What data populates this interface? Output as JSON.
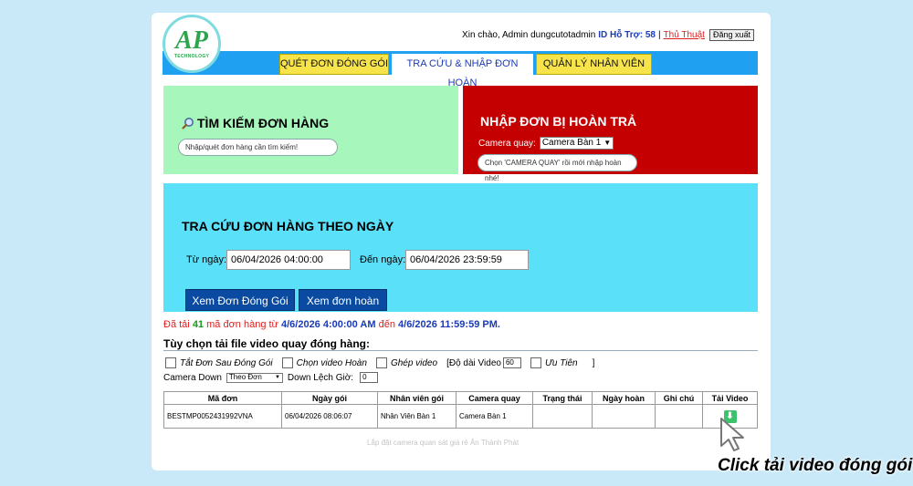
{
  "brand": {
    "logo_text": "AP",
    "logo_sub": "TECHNOLOGY"
  },
  "header": {
    "greeting": "Xin chào, Admin dungcutotadmin",
    "support": "ID Hỗ Trợ: 58",
    "sep": "|",
    "tips": "Thủ Thuật",
    "logout": "Đăng xuất"
  },
  "tabs": [
    {
      "label": "QUÉT ĐƠN ĐÓNG GÓI",
      "active": false
    },
    {
      "label": "TRA CỨU & NHẬP ĐƠN HOÀN",
      "active": true
    },
    {
      "label": "QUẢN LÝ NHÂN VIÊN",
      "active": false
    }
  ],
  "search_panel": {
    "icon": "magnifier-icon",
    "title": "TÌM KIẾM ĐƠN HÀNG",
    "placeholder": "Nhập/quét đơn hàng cần tìm kiếm!",
    "color": "#a7f7bc"
  },
  "return_panel": {
    "title": "NHẬP ĐƠN BỊ HOÀN TRẢ",
    "camera_label": "Camera quay:",
    "camera_value": "Camera Bàn 1",
    "placeholder": "Chọn 'CAMERA QUAY' rồi mới nhập hoàn nhé!",
    "color": "#c40000"
  },
  "date_panel": {
    "title": "TRA CỨU ĐƠN HÀNG THEO NGÀY",
    "from_label": "Từ ngày:",
    "from_value": "06/04/2026 04:00:00",
    "to_label": "Đến ngày:",
    "to_value": "06/04/2026 23:59:59",
    "btn_packed": "Xem Đơn Đóng Gói",
    "btn_returned": "Xem đơn hoàn",
    "color": "#5ae0f8"
  },
  "status": {
    "prefix": "Đã tải",
    "count": "41",
    "mid": "mã đơn hàng từ",
    "from": "4/6/2026 4:00:00 AM",
    "to_word": "đến",
    "to": "4/6/2026 11:59:59 PM",
    "end": "."
  },
  "options": {
    "title": "Tùy chọn tải file video quay đóng hàng:",
    "opt1": "Tắt Đơn Sau Đóng Gói",
    "opt2": "Chọn video Hoàn",
    "opt3": "Ghép video",
    "duration_label": "[Độ dài Video",
    "duration_value": "60",
    "opt4": "Ưu Tiên",
    "close_bracket": "]",
    "camera_down_label": "Camera Down",
    "camera_down_value": "Theo Đơn",
    "offset_label": "Down Lệch Giờ:",
    "offset_value": "0"
  },
  "table": {
    "headers": [
      "Mã đơn",
      "Ngày gói",
      "Nhân viên gói",
      "Camera quay",
      "Trạng thái",
      "Ngày hoàn",
      "Ghi chú",
      "Tải Video"
    ],
    "rows": [
      [
        "BESTMP0052431992VNA",
        "06/04/2026 08:06:07",
        "Nhân Viên Bàn 1",
        "Camera Bàn 1",
        "",
        "",
        "",
        ""
      ]
    ]
  },
  "footer_image_alt": "Lắp đặt camera quan sát giá rẻ Ân Thành Phát",
  "callout": "Click tải video đóng gói"
}
